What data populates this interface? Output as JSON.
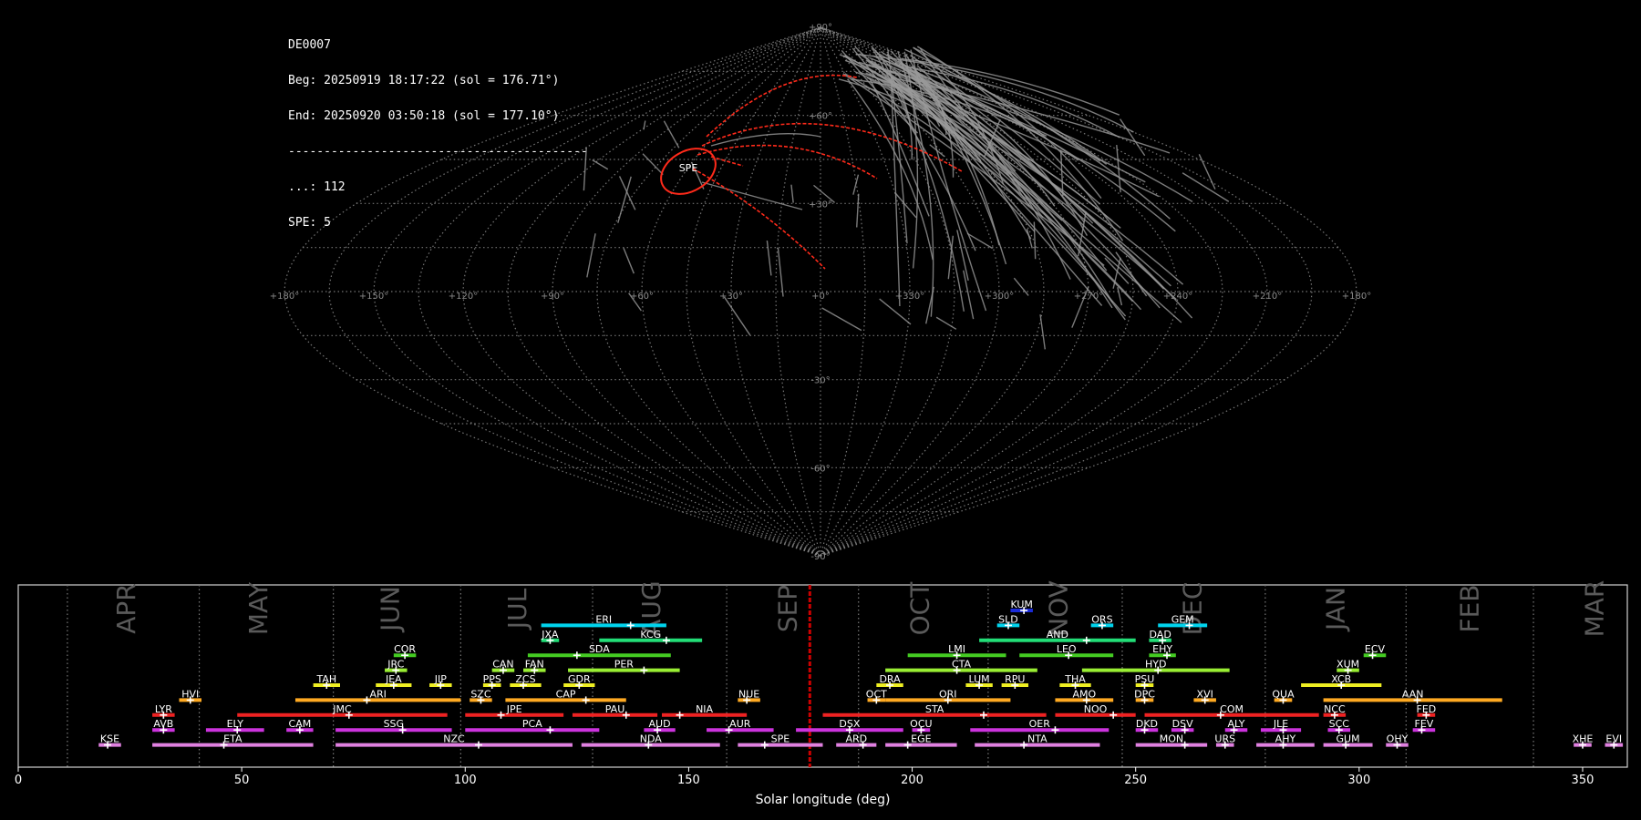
{
  "info": {
    "station": "DE0007",
    "begin": "Beg: 20250919 18:17:22 (sol = 176.71°)",
    "end": "End: 20250920 03:50:18 (sol = 177.10°)",
    "separator": "------------------------------------------",
    "sporadic_count": "...: 112",
    "spe_count": "SPE: 5"
  },
  "colors": {
    "background": "#000000",
    "grid": "#8a8a8a",
    "sporadic_trail": "#9a9a9a",
    "shower_trail": "#ff2a1a",
    "current_sol": "#cc0000"
  },
  "chart_data": [
    {
      "type": "scatter",
      "projection": "sinusoidal",
      "highlight_label": "SPE",
      "highlight_center": {
        "lon": 57,
        "lat": 40
      },
      "longitude_ticks": [
        "+180°",
        "+150°",
        "+120°",
        "+90°",
        "+60°",
        "+30°",
        "+0°",
        "+330°",
        "+300°",
        "+270°",
        "+240°",
        "+210°",
        "+180°"
      ],
      "latitude_ticks": [
        "+90°",
        "+60°",
        "+30°",
        "-30°",
        "-60°",
        "-90°"
      ]
    },
    {
      "type": "bar",
      "xlabel": "Solar longitude (deg)",
      "xlim": [
        0,
        360
      ],
      "x_ticks": [
        0,
        50,
        100,
        150,
        200,
        250,
        300,
        350
      ],
      "current_sol": 177.1,
      "month_boundaries": [
        11,
        40.5,
        70.5,
        99,
        128.5,
        158.5,
        188,
        217,
        247,
        279,
        310.5,
        339
      ],
      "months": [
        {
          "label": "APR",
          "x": 24.5
        },
        {
          "label": "MAY",
          "x": 54
        },
        {
          "label": "JUN",
          "x": 83.5
        },
        {
          "label": "JUL",
          "x": 112
        },
        {
          "label": "AUG",
          "x": 142
        },
        {
          "label": "SEP",
          "x": 172.5
        },
        {
          "label": "OCT",
          "x": 202
        },
        {
          "label": "NOV",
          "x": 233
        },
        {
          "label": "DEC",
          "x": 263
        },
        {
          "label": "JAN",
          "x": 295
        },
        {
          "label": "FEB",
          "x": 325
        },
        {
          "label": "MAR",
          "x": 353
        }
      ],
      "showers": [
        {
          "code": "KUM",
          "start": 222,
          "end": 227,
          "peak": 225,
          "row": 1,
          "color": "#1a2bd8"
        },
        {
          "code": "ERI",
          "start": 117,
          "end": 145,
          "peak": 137,
          "row": 2,
          "color": "#00d4ee"
        },
        {
          "code": "SLD",
          "start": 219,
          "end": 224,
          "peak": 221.5,
          "row": 2,
          "color": "#00d4ee"
        },
        {
          "code": "ORS",
          "start": 240,
          "end": 245,
          "peak": 242.5,
          "row": 2,
          "color": "#00d4ee"
        },
        {
          "code": "GEM",
          "start": 255,
          "end": 266,
          "peak": 262,
          "row": 2,
          "color": "#00d4ee"
        },
        {
          "code": "JXA",
          "start": 117,
          "end": 121,
          "peak": 119,
          "row": 3,
          "color": "#22dd77"
        },
        {
          "code": "KCG",
          "start": 130,
          "end": 153,
          "peak": 145,
          "row": 3,
          "color": "#22dd77"
        },
        {
          "code": "AND",
          "start": 215,
          "end": 250,
          "peak": 239,
          "row": 3,
          "color": "#22dd77"
        },
        {
          "code": "DAD",
          "start": 253,
          "end": 258,
          "peak": 256,
          "row": 3,
          "color": "#22dd77"
        },
        {
          "code": "COR",
          "start": 84,
          "end": 89,
          "peak": 86.5,
          "row": 4,
          "color": "#44cc22"
        },
        {
          "code": "SDA",
          "start": 114,
          "end": 146,
          "peak": 125,
          "row": 4,
          "color": "#44cc22"
        },
        {
          "code": "LMI",
          "start": 199,
          "end": 221,
          "peak": 210,
          "row": 4,
          "color": "#44cc22"
        },
        {
          "code": "LEO",
          "start": 224,
          "end": 245,
          "peak": 235,
          "row": 4,
          "color": "#44cc22"
        },
        {
          "code": "EHY",
          "start": 253,
          "end": 259,
          "peak": 257,
          "row": 4,
          "color": "#44cc22"
        },
        {
          "code": "ECV",
          "start": 301,
          "end": 306,
          "peak": 303,
          "row": 4,
          "color": "#44cc22"
        },
        {
          "code": "JRC",
          "start": 82,
          "end": 87,
          "peak": 84.5,
          "row": 5,
          "color": "#99ee33"
        },
        {
          "code": "CAN",
          "start": 106,
          "end": 111,
          "peak": 108.5,
          "row": 5,
          "color": "#99ee33"
        },
        {
          "code": "FAN",
          "start": 113,
          "end": 118,
          "peak": 115.5,
          "row": 5,
          "color": "#99ee33"
        },
        {
          "code": "PER",
          "start": 123,
          "end": 148,
          "peak": 140,
          "row": 5,
          "color": "#99ee33"
        },
        {
          "code": "CTA",
          "start": 194,
          "end": 228,
          "peak": 210,
          "row": 5,
          "color": "#99ee33"
        },
        {
          "code": "HYD",
          "start": 238,
          "end": 271,
          "peak": 255,
          "row": 5,
          "color": "#99ee33"
        },
        {
          "code": "XUM",
          "start": 295,
          "end": 300,
          "peak": 297.5,
          "row": 5,
          "color": "#99ee33"
        },
        {
          "code": "TAH",
          "start": 66,
          "end": 72,
          "peak": 69,
          "row": 6,
          "color": "#eeee22"
        },
        {
          "code": "JEA",
          "start": 80,
          "end": 88,
          "peak": 84,
          "row": 6,
          "color": "#eeee22"
        },
        {
          "code": "JIP",
          "start": 92,
          "end": 97,
          "peak": 94.5,
          "row": 6,
          "color": "#eeee22"
        },
        {
          "code": "PPS",
          "start": 104,
          "end": 108,
          "peak": 106,
          "row": 6,
          "color": "#eeee22"
        },
        {
          "code": "ZCS",
          "start": 110,
          "end": 117,
          "peak": 113,
          "row": 6,
          "color": "#eeee22"
        },
        {
          "code": "GDR",
          "start": 122,
          "end": 129,
          "peak": 125.5,
          "row": 6,
          "color": "#eeee22"
        },
        {
          "code": "DRA",
          "start": 192,
          "end": 198,
          "peak": 195,
          "row": 6,
          "color": "#eeee22"
        },
        {
          "code": "LUM",
          "start": 212,
          "end": 218,
          "peak": 215,
          "row": 6,
          "color": "#eeee22"
        },
        {
          "code": "RPU",
          "start": 220,
          "end": 226,
          "peak": 223,
          "row": 6,
          "color": "#eeee22"
        },
        {
          "code": "THA",
          "start": 233,
          "end": 240,
          "peak": 236.5,
          "row": 6,
          "color": "#eeee22"
        },
        {
          "code": "PSU",
          "start": 250,
          "end": 254,
          "peak": 252,
          "row": 6,
          "color": "#eeee22"
        },
        {
          "code": "XCB",
          "start": 287,
          "end": 305,
          "peak": 296,
          "row": 6,
          "color": "#eeee22"
        },
        {
          "code": "HVI",
          "start": 36,
          "end": 41,
          "peak": 38.5,
          "row": 7,
          "color": "#ffaa22"
        },
        {
          "code": "ARI",
          "start": 62,
          "end": 99,
          "peak": 78,
          "row": 7,
          "color": "#ffaa22"
        },
        {
          "code": "SZC",
          "start": 101,
          "end": 106,
          "peak": 103.5,
          "row": 7,
          "color": "#ffaa22"
        },
        {
          "code": "CAP",
          "start": 109,
          "end": 136,
          "peak": 127,
          "row": 7,
          "color": "#ffaa22"
        },
        {
          "code": "NUE",
          "start": 161,
          "end": 166,
          "peak": 163,
          "row": 7,
          "color": "#ffaa22"
        },
        {
          "code": "OCT",
          "start": 190,
          "end": 194,
          "peak": 192,
          "row": 7,
          "color": "#ffaa22"
        },
        {
          "code": "ORI",
          "start": 194,
          "end": 222,
          "peak": 208,
          "row": 7,
          "color": "#ffaa22"
        },
        {
          "code": "AMO",
          "start": 232,
          "end": 245,
          "peak": 239,
          "row": 7,
          "color": "#ffaa22"
        },
        {
          "code": "DPC",
          "start": 250,
          "end": 254,
          "peak": 252,
          "row": 7,
          "color": "#ffaa22"
        },
        {
          "code": "XVI",
          "start": 263,
          "end": 268,
          "peak": 265.5,
          "row": 7,
          "color": "#ffaa22"
        },
        {
          "code": "QUA",
          "start": 281,
          "end": 285,
          "peak": 283,
          "row": 7,
          "color": "#ffaa22"
        },
        {
          "code": "AAN",
          "start": 292,
          "end": 332,
          "peak": 313,
          "row": 7,
          "color": "#ffaa22"
        },
        {
          "code": "LYR",
          "start": 30,
          "end": 35,
          "peak": 32.5,
          "row": 8,
          "color": "#ee2222"
        },
        {
          "code": "JMC",
          "start": 49,
          "end": 96,
          "peak": 74,
          "row": 8,
          "color": "#ee2222"
        },
        {
          "code": "JPE",
          "start": 100,
          "end": 122,
          "peak": 108,
          "row": 8,
          "color": "#ee2222"
        },
        {
          "code": "PAU",
          "start": 124,
          "end": 143,
          "peak": 136,
          "row": 8,
          "color": "#ee2222"
        },
        {
          "code": "NIA",
          "start": 144,
          "end": 163,
          "peak": 148,
          "row": 8,
          "color": "#ee2222"
        },
        {
          "code": "STA",
          "start": 180,
          "end": 230,
          "peak": 216,
          "row": 8,
          "color": "#ee2222"
        },
        {
          "code": "NOO",
          "start": 232,
          "end": 250,
          "peak": 245,
          "row": 8,
          "color": "#ee2222"
        },
        {
          "code": "COM",
          "start": 252,
          "end": 291,
          "peak": 269,
          "row": 8,
          "color": "#ee2222"
        },
        {
          "code": "NCC",
          "start": 292,
          "end": 297,
          "peak": 294.5,
          "row": 8,
          "color": "#ee2222"
        },
        {
          "code": "FED",
          "start": 313,
          "end": 317,
          "peak": 315,
          "row": 8,
          "color": "#ee2222"
        },
        {
          "code": "AVB",
          "start": 30,
          "end": 35,
          "peak": 32.5,
          "row": 9,
          "color": "#cc33dd"
        },
        {
          "code": "ELY",
          "start": 42,
          "end": 55,
          "peak": 49,
          "row": 9,
          "color": "#cc33dd"
        },
        {
          "code": "CAM",
          "start": 60,
          "end": 66,
          "peak": 63,
          "row": 9,
          "color": "#cc33dd"
        },
        {
          "code": "SSG",
          "start": 71,
          "end": 97,
          "peak": 86,
          "row": 9,
          "color": "#cc33dd"
        },
        {
          "code": "PCA",
          "start": 100,
          "end": 130,
          "peak": 119,
          "row": 9,
          "color": "#cc33dd"
        },
        {
          "code": "AUD",
          "start": 140,
          "end": 147,
          "peak": 143,
          "row": 9,
          "color": "#cc33dd"
        },
        {
          "code": "AUR",
          "start": 154,
          "end": 169,
          "peak": 159,
          "row": 9,
          "color": "#cc33dd"
        },
        {
          "code": "DSX",
          "start": 174,
          "end": 198,
          "peak": 186,
          "row": 9,
          "color": "#cc33dd"
        },
        {
          "code": "OCU",
          "start": 200,
          "end": 204,
          "peak": 202,
          "row": 9,
          "color": "#cc33dd"
        },
        {
          "code": "OER",
          "start": 213,
          "end": 244,
          "peak": 232,
          "row": 9,
          "color": "#cc33dd"
        },
        {
          "code": "DKD",
          "start": 250,
          "end": 255,
          "peak": 252,
          "row": 9,
          "color": "#cc33dd"
        },
        {
          "code": "DSV",
          "start": 258,
          "end": 263,
          "peak": 261,
          "row": 9,
          "color": "#cc33dd"
        },
        {
          "code": "ALY",
          "start": 270,
          "end": 275,
          "peak": 272,
          "row": 9,
          "color": "#cc33dd"
        },
        {
          "code": "JLE",
          "start": 278,
          "end": 287,
          "peak": 283,
          "row": 9,
          "color": "#cc33dd"
        },
        {
          "code": "SCC",
          "start": 293,
          "end": 298,
          "peak": 295.5,
          "row": 9,
          "color": "#cc33dd"
        },
        {
          "code": "FEV",
          "start": 312,
          "end": 317,
          "peak": 314,
          "row": 9,
          "color": "#cc33dd"
        },
        {
          "code": "KSE",
          "start": 18,
          "end": 23,
          "peak": 20,
          "row": 10,
          "color": "#e080e0"
        },
        {
          "code": "ETA",
          "start": 30,
          "end": 66,
          "peak": 46,
          "row": 10,
          "color": "#e080e0"
        },
        {
          "code": "NZC",
          "start": 71,
          "end": 124,
          "peak": 103,
          "row": 10,
          "color": "#e080e0"
        },
        {
          "code": "NDA",
          "start": 126,
          "end": 157,
          "peak": 141,
          "row": 10,
          "color": "#e080e0"
        },
        {
          "code": "SPE",
          "start": 161,
          "end": 180,
          "peak": 167,
          "row": 10,
          "color": "#e080e0"
        },
        {
          "code": "ARD",
          "start": 183,
          "end": 192,
          "peak": 189,
          "row": 10,
          "color": "#e080e0"
        },
        {
          "code": "EGE",
          "start": 194,
          "end": 210,
          "peak": 199,
          "row": 10,
          "color": "#e080e0"
        },
        {
          "code": "NTA",
          "start": 214,
          "end": 242,
          "peak": 225,
          "row": 10,
          "color": "#e080e0"
        },
        {
          "code": "MON",
          "start": 250,
          "end": 266,
          "peak": 261,
          "row": 10,
          "color": "#e080e0"
        },
        {
          "code": "URS",
          "start": 268,
          "end": 272,
          "peak": 270,
          "row": 10,
          "color": "#e080e0"
        },
        {
          "code": "AHY",
          "start": 277,
          "end": 290,
          "peak": 283,
          "row": 10,
          "color": "#e080e0"
        },
        {
          "code": "GUM",
          "start": 292,
          "end": 303,
          "peak": 297,
          "row": 10,
          "color": "#e080e0"
        },
        {
          "code": "OHY",
          "start": 306,
          "end": 311,
          "peak": 308.5,
          "row": 10,
          "color": "#e080e0"
        },
        {
          "code": "XHE",
          "start": 348,
          "end": 352,
          "peak": 350,
          "row": 10,
          "color": "#e080e0"
        },
        {
          "code": "EVI",
          "start": 355,
          "end": 359,
          "peak": 357,
          "row": 10,
          "color": "#e080e0"
        }
      ]
    }
  ]
}
